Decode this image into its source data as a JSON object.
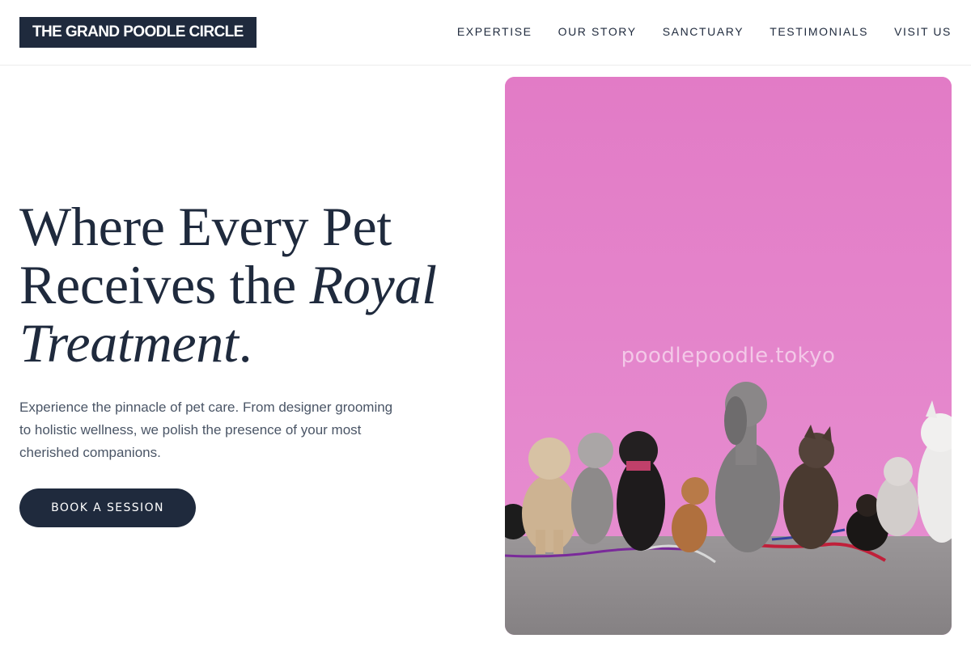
{
  "brand": {
    "name": "THE GRAND POODLE CIRCLE"
  },
  "nav": {
    "items": [
      {
        "label": "EXPERTISE"
      },
      {
        "label": "OUR STORY"
      },
      {
        "label": "SANCTUARY"
      },
      {
        "label": "TESTIMONIALS"
      },
      {
        "label": "VISIT US"
      }
    ]
  },
  "hero": {
    "headline_line1": "Where Every Pet",
    "headline_line2_plain": "Receives the ",
    "headline_line2_italic": "Royal",
    "headline_line3_italic": "Treatment",
    "headline_line3_end": ".",
    "subtext": "Experience the pinnacle of pet care. From designer grooming to holistic wellness, we polish the presence of your most cherished companions.",
    "cta_label": "BOOK A SESSION"
  },
  "photo": {
    "watermark": "poodlepoodle.tokyo",
    "subject": "row of dogs sitting against a pink wall"
  },
  "colors": {
    "navy": "#1f2a3d",
    "wall_pink": "#e27ec8",
    "pavement": "#8d8a8c",
    "body_text": "#4a5566"
  }
}
